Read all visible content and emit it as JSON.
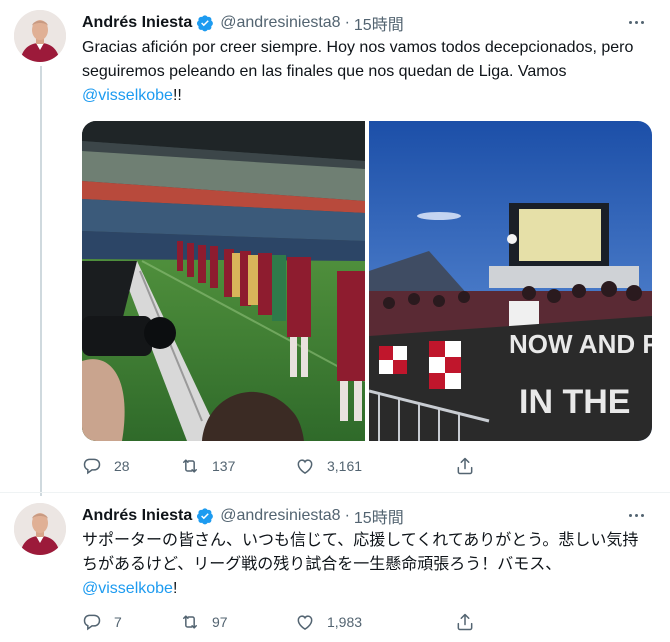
{
  "tweets": [
    {
      "author": {
        "name": "Andrés Iniesta",
        "handle": "@andresiniesta8",
        "verified": true
      },
      "time": "15時間",
      "text_main": "Gracias afición por creer siempre. Hoy nos vamos todos decepcionados, pero seguiremos peleando en las finales que nos quedan de Liga. Vamos",
      "mention": "@visselkobe",
      "text_end": "!!",
      "media": [
        "stadium-players-photo",
        "supporters-stand-photo"
      ],
      "stats": {
        "replies": "28",
        "retweets": "137",
        "likes": "3,161"
      }
    },
    {
      "author": {
        "name": "Andrés Iniesta",
        "handle": "@andresiniesta8",
        "verified": true
      },
      "time": "15時間",
      "text_main": "サポーターの皆さん、いつも信じて、応援してくれてありがとう。悲しい気持ちがあるけど、リーグ戦の残り試合を一生懸命頑張ろう！バモス、",
      "mention": "@visselkobe",
      "text_end": "!",
      "stats": {
        "replies": "7",
        "retweets": "97",
        "likes": "1,983"
      }
    }
  ],
  "icons": [
    "verified-badge-icon",
    "more-icon",
    "reply-icon",
    "retweet-icon",
    "like-icon",
    "share-icon"
  ],
  "colors": {
    "accent": "#1d9bf0",
    "muted": "#536471",
    "text": "#0f1419"
  },
  "banner_text": {
    "line1": "NOW AND F",
    "line2": "IN THE"
  }
}
